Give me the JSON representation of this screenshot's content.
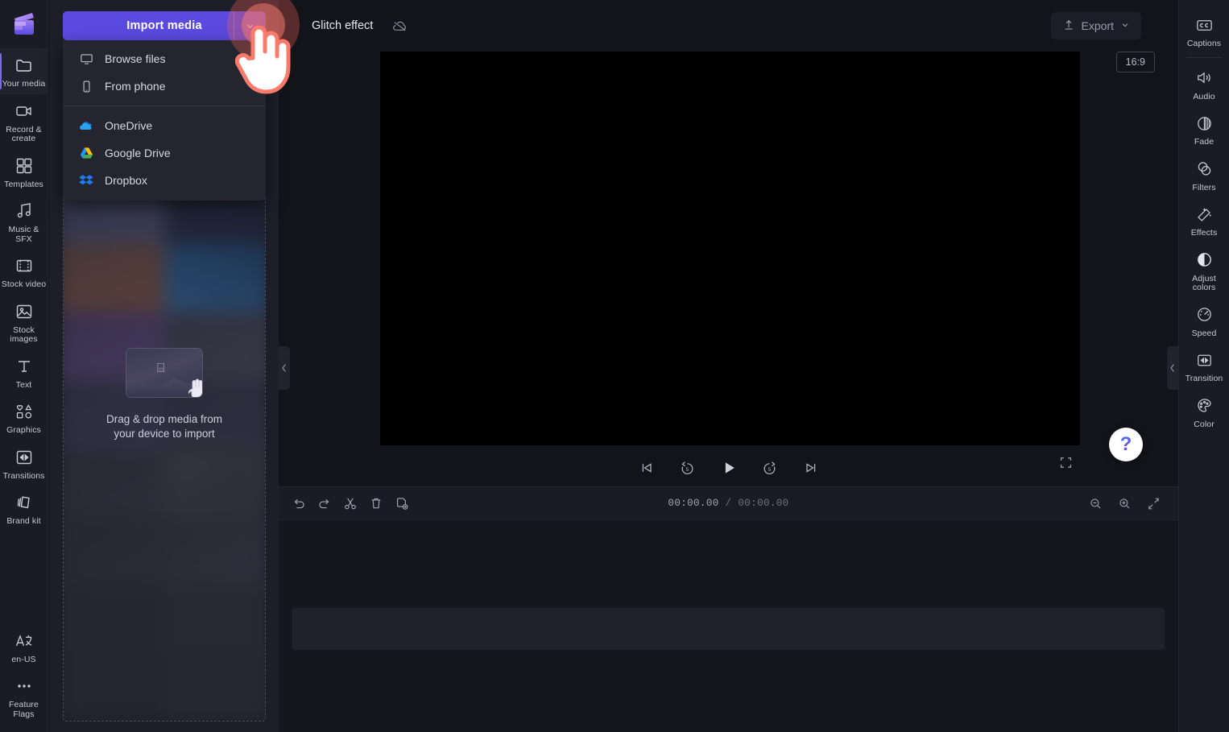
{
  "app": {
    "name": "Clipchamp",
    "logo_icon": "clapperboard-logo"
  },
  "left_rail": {
    "items": [
      {
        "id": "your-media",
        "label": "Your media",
        "icon": "folder-icon",
        "active": true
      },
      {
        "id": "record-create",
        "label": "Record & create",
        "icon": "video-camera-icon",
        "active": false
      },
      {
        "id": "templates",
        "label": "Templates",
        "icon": "templates-grid-icon",
        "active": false
      },
      {
        "id": "music-sfx",
        "label": "Music & SFX",
        "icon": "music-note-icon",
        "active": false
      },
      {
        "id": "stock-video",
        "label": "Stock video",
        "icon": "film-strip-icon",
        "active": false
      },
      {
        "id": "stock-images",
        "label": "Stock images",
        "icon": "image-icon",
        "active": false
      },
      {
        "id": "text",
        "label": "Text",
        "icon": "text-t-icon",
        "active": false
      },
      {
        "id": "graphics",
        "label": "Graphics",
        "icon": "shapes-icon",
        "active": false
      },
      {
        "id": "transitions",
        "label": "Transitions",
        "icon": "transition-icon",
        "active": false
      },
      {
        "id": "brand-kit",
        "label": "Brand kit",
        "icon": "brand-kit-icon",
        "active": false
      }
    ],
    "bottom_items": [
      {
        "id": "language",
        "label": "en-US",
        "icon": "language-icon"
      },
      {
        "id": "feature-flags",
        "label": "Feature Flags",
        "icon": "ellipsis-icon"
      }
    ]
  },
  "media_panel": {
    "import_button": {
      "label": "Import media",
      "caret_icon": "chevron-down-icon"
    },
    "import_menu": {
      "items": [
        {
          "id": "browse-files",
          "label": "Browse files",
          "icon": "monitor-icon"
        },
        {
          "id": "from-phone",
          "label": "From phone",
          "icon": "phone-icon"
        }
      ],
      "cloud_items": [
        {
          "id": "onedrive",
          "label": "OneDrive",
          "icon": "onedrive-icon"
        },
        {
          "id": "google-drive",
          "label": "Google Drive",
          "icon": "google-drive-icon"
        },
        {
          "id": "dropbox",
          "label": "Dropbox",
          "icon": "dropbox-icon"
        }
      ]
    },
    "dropzone": {
      "message_line1": "Drag & drop media from",
      "message_line2": "your device to import",
      "thumb_icon": "media-thumbnail",
      "hand_icon": "drag-hand-icon"
    }
  },
  "topbar": {
    "project_title": "Glitch effect",
    "cloud_status_icon": "cloud-off-icon",
    "export": {
      "label": "Export",
      "icon": "upload-arrow-icon",
      "caret_icon": "chevron-down-icon"
    }
  },
  "preview": {
    "aspect_ratio": "16:9",
    "controls": [
      {
        "id": "skip-start",
        "icon": "skip-to-start-icon"
      },
      {
        "id": "rewind-5",
        "icon": "rewind-5s-icon",
        "label": "5"
      },
      {
        "id": "play",
        "icon": "play-icon"
      },
      {
        "id": "forward-5",
        "icon": "forward-5s-icon",
        "label": "5"
      },
      {
        "id": "skip-end",
        "icon": "skip-to-end-icon"
      }
    ],
    "fullscreen_icon": "fullscreen-icon",
    "help_label": "?"
  },
  "timeline": {
    "tools": [
      {
        "id": "undo",
        "icon": "undo-icon"
      },
      {
        "id": "redo",
        "icon": "redo-icon"
      },
      {
        "id": "split",
        "icon": "scissors-icon"
      },
      {
        "id": "delete",
        "icon": "trash-icon"
      },
      {
        "id": "duplicate",
        "icon": "duplicate-clip-icon"
      }
    ],
    "current_time": "00:00.00",
    "time_separator": " / ",
    "total_time": "00:00.00",
    "zoom_tools": [
      {
        "id": "zoom-out",
        "icon": "zoom-out-icon"
      },
      {
        "id": "zoom-in",
        "icon": "zoom-in-icon"
      },
      {
        "id": "fit",
        "icon": "fit-to-screen-icon"
      }
    ]
  },
  "right_rail": {
    "items": [
      {
        "id": "captions",
        "label": "Captions",
        "icon": "closed-caption-icon"
      },
      {
        "id": "audio",
        "label": "Audio",
        "icon": "speaker-icon"
      },
      {
        "id": "fade",
        "label": "Fade",
        "icon": "fade-circle-icon"
      },
      {
        "id": "filters",
        "label": "Filters",
        "icon": "filters-overlap-icon"
      },
      {
        "id": "effects",
        "label": "Effects",
        "icon": "magic-wand-icon"
      },
      {
        "id": "adjust-colors",
        "label": "Adjust colors",
        "icon": "contrast-icon"
      },
      {
        "id": "speed",
        "label": "Speed",
        "icon": "speedometer-icon"
      },
      {
        "id": "transition",
        "label": "Transition",
        "icon": "transition-icon"
      },
      {
        "id": "color",
        "label": "Color",
        "icon": "palette-icon"
      }
    ]
  },
  "overlay": {
    "click_indicator": "click-ripple",
    "cursor": "pointing-hand-cursor"
  },
  "colors": {
    "accent": "#5b4ae0",
    "panel_bg": "#1e1e29",
    "rail_bg": "#1b1b26",
    "canvas_bg": "#13131a",
    "click_ripple": "#f05f55",
    "cursor_outline": "#fa7a6b"
  }
}
